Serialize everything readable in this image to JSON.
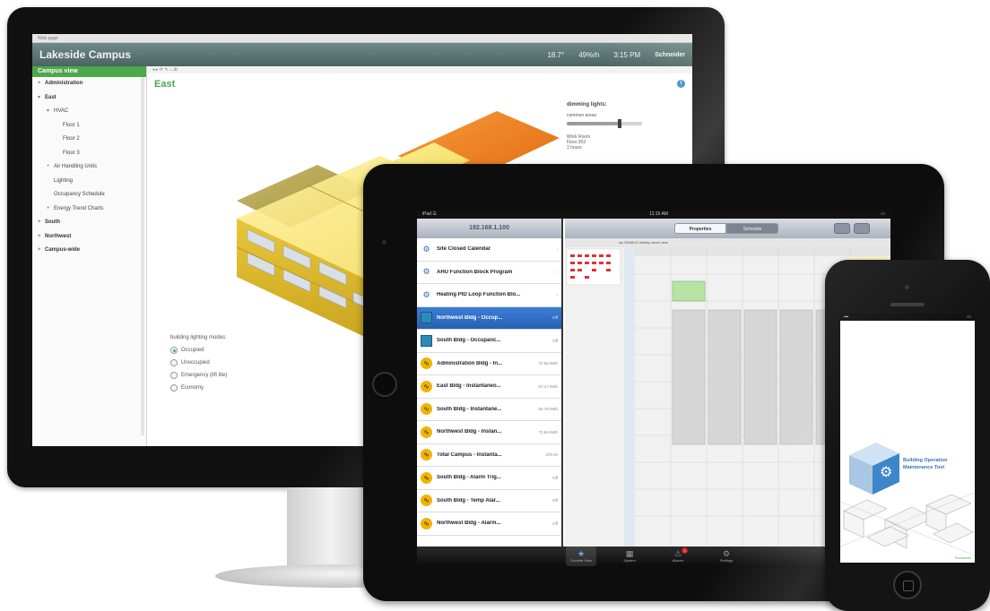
{
  "monitor": {
    "browser_tab": "Web page",
    "app": {
      "title": "Lakeside Campus",
      "temperature": "18.7°",
      "humidity": "49%rh",
      "time": "3:15 PM",
      "brand": "Schneider"
    },
    "sidebar": {
      "header": "Campus view",
      "items": [
        {
          "label": "Administration",
          "indent": 0,
          "bold": true,
          "marker": "+"
        },
        {
          "label": "East",
          "indent": 0,
          "bold": true,
          "marker": "▾"
        },
        {
          "label": "HVAC",
          "indent": 1,
          "bold": false,
          "marker": "▾"
        },
        {
          "label": "Floor 1",
          "indent": 2,
          "bold": false,
          "marker": ""
        },
        {
          "label": "Floor 2",
          "indent": 2,
          "bold": false,
          "marker": ""
        },
        {
          "label": "Floor 3",
          "indent": 2,
          "bold": false,
          "marker": ""
        },
        {
          "label": "Air Handling Units",
          "indent": 1,
          "bold": false,
          "marker": "+"
        },
        {
          "label": "Lighting",
          "indent": 1,
          "bold": false,
          "marker": ""
        },
        {
          "label": "Occupancy Schedule",
          "indent": 1,
          "bold": false,
          "marker": ""
        },
        {
          "label": "Energy Trend Charts",
          "indent": 1,
          "bold": false,
          "marker": "+"
        },
        {
          "label": "South",
          "indent": 0,
          "bold": true,
          "marker": "+"
        },
        {
          "label": "Northwest",
          "indent": 0,
          "bold": true,
          "marker": "+"
        },
        {
          "label": "Campus-wide",
          "indent": 0,
          "bold": true,
          "marker": "+"
        }
      ]
    },
    "main": {
      "title": "East",
      "toolbar": "◂ ▸ ⟳ ✎ ⌂ ⊞",
      "dimming": {
        "title": "dimming lights:",
        "first_label": "common areas",
        "first_level": 0.7,
        "second_label": "Work Room",
        "second_sub": "Floor 302",
        "second_extra": "1 hours"
      },
      "modes": {
        "title": "building lighting modes:",
        "options": [
          "Occupied",
          "Unoccupied",
          "Emergency (lift lite)",
          "Economy"
        ],
        "selected": 0
      }
    }
  },
  "tablet": {
    "status": {
      "carrier": "iPad ☰",
      "time": "11:15 AM",
      "battery": "▭"
    },
    "master": {
      "title": "192.168.1.100",
      "rows": [
        {
          "label": "Site Closed Calendar",
          "value": "›",
          "icon": "sched"
        },
        {
          "label": "AHU Function Block Program",
          "value": "›",
          "icon": "sched"
        },
        {
          "label": "Heating PID Loop Function Blo...",
          "value": "›",
          "icon": "sched"
        },
        {
          "label": "Northwest Bldg - Occup...",
          "value": "Off",
          "icon": "cal",
          "selected": true
        },
        {
          "label": "South Bldg - Occupanc...",
          "value": "Off",
          "icon": "cal"
        },
        {
          "label": "Administration Bldg - In...",
          "value": "72.66 kWh",
          "icon": "dot"
        },
        {
          "label": "East Bldg - Instantaneo...",
          "value": "67.17 kWh",
          "icon": "dot"
        },
        {
          "label": "South Bldg - Instantane...",
          "value": "50.78 kWh",
          "icon": "dot"
        },
        {
          "label": "Northwest Bldg - Instan...",
          "value": "72.89 kWh",
          "icon": "dot"
        },
        {
          "label": "Total Campus - Instanta...",
          "value": "370 kh",
          "icon": "dot"
        },
        {
          "label": "South Bldg - Alarm Trig...",
          "value": "Off",
          "icon": "dot"
        },
        {
          "label": "South Bldg - Temp Alar...",
          "value": "Off",
          "icon": "dot"
        },
        {
          "label": "Northwest Bldg - Alarm...",
          "value": "Off",
          "icon": "dot"
        }
      ]
    },
    "detail": {
      "segment_left": "Properties",
      "segment_right": "Schedule",
      "toolbar": "◂ ▸ 05/08/12  weekly  week view"
    },
    "tabbar": [
      {
        "label": "Favorite View",
        "glyph": "★",
        "active": true
      },
      {
        "label": "System",
        "glyph": "▦"
      },
      {
        "label": "Alarms",
        "glyph": "⚠",
        "badge": "3"
      },
      {
        "label": "Settings",
        "glyph": "⚙"
      }
    ]
  },
  "phone": {
    "status": {
      "carrier": "▪▪▪",
      "time": "",
      "battery": "▭"
    },
    "splash_title_line1": "Building Operation",
    "splash_title_line2": "Maintenance Tool",
    "footer": "Schneider"
  }
}
